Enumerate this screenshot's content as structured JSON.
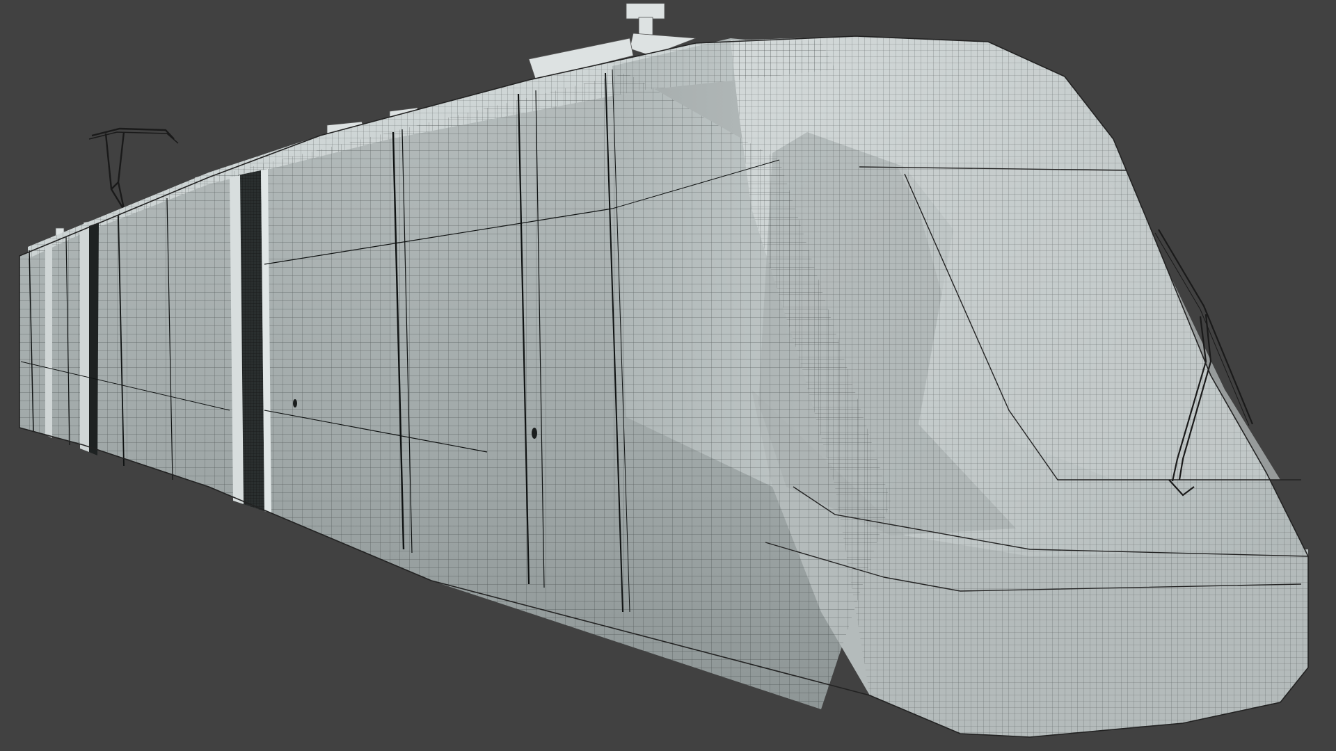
{
  "viewport": {
    "background": "#414141",
    "shading_mode": "wireframe-on-shaded",
    "subject": "tram",
    "colors": {
      "surface_light": "#c9d0d0",
      "surface_mid": "#aab2b2",
      "surface_dark": "#7f8787",
      "wire": "#1c2020"
    }
  }
}
